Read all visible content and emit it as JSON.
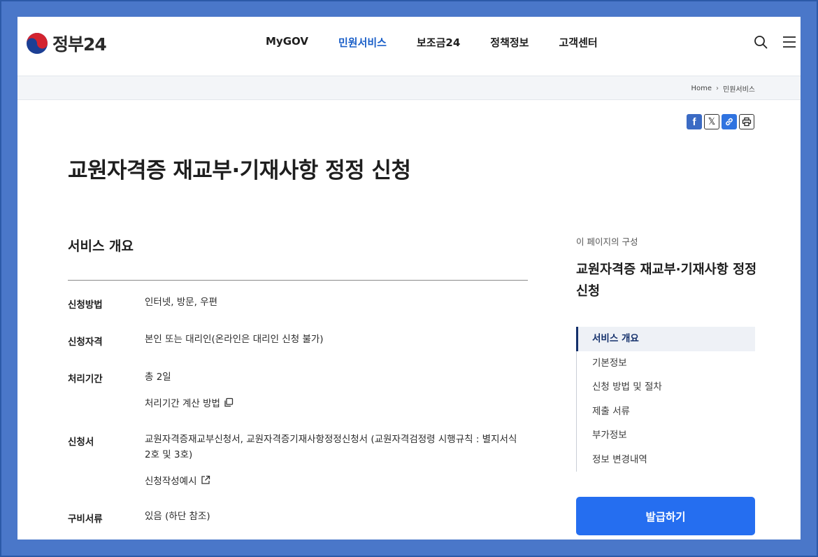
{
  "header": {
    "logo_text": "정부24",
    "nav": [
      "MyGOV",
      "민원서비스",
      "보조금24",
      "정책정보",
      "고객센터"
    ],
    "active_nav": "민원서비스"
  },
  "breadcrumb": {
    "home": "Home",
    "current": "민원서비스"
  },
  "share": {
    "facebook": "f",
    "x": "𝕏"
  },
  "page_title": "교원자격증 재교부·기재사항 정정 신청",
  "overview": {
    "section_title": "서비스 개요",
    "rows": [
      {
        "label": "신청방법",
        "value": "인터넷, 방문, 우편"
      },
      {
        "label": "신청자격",
        "value": "본인 또는 대리인(온라인은 대리인 신청 불가)"
      },
      {
        "label": "처리기간",
        "value": "총 2일",
        "link": "처리기간 계산 방법"
      },
      {
        "label": "신청서",
        "value_line1": "교원자격증재교부신청서, 교원자격증기재사항정정신청서 (교원자격검정령 시행규칙 : 별지서식",
        "value_line2": "2호 및 3호)",
        "link": "신청작성예시"
      },
      {
        "label": "구비서류",
        "value": "있음 (하단 참조)"
      }
    ]
  },
  "toc": {
    "caption": "이 페이지의 구성",
    "title": "교원자격증 재교부·기재사항 정정 신청",
    "items": [
      "서비스 개요",
      "기본정보",
      "신청 방법 및 절차",
      "제출 서류",
      "부가정보",
      "정보 변경내역"
    ],
    "active_index": 0
  },
  "issue_button": "발급하기",
  "colors": {
    "accent": "#256ef0",
    "nav_active": "#1a5fc8",
    "toc_active": "#14306b",
    "background": "#4a77c9"
  },
  "icons": [
    "taegeuk-logo",
    "search-icon",
    "menu-icon",
    "facebook-icon",
    "x-icon",
    "link-icon",
    "print-icon",
    "copy-icon",
    "external-link-icon"
  ]
}
